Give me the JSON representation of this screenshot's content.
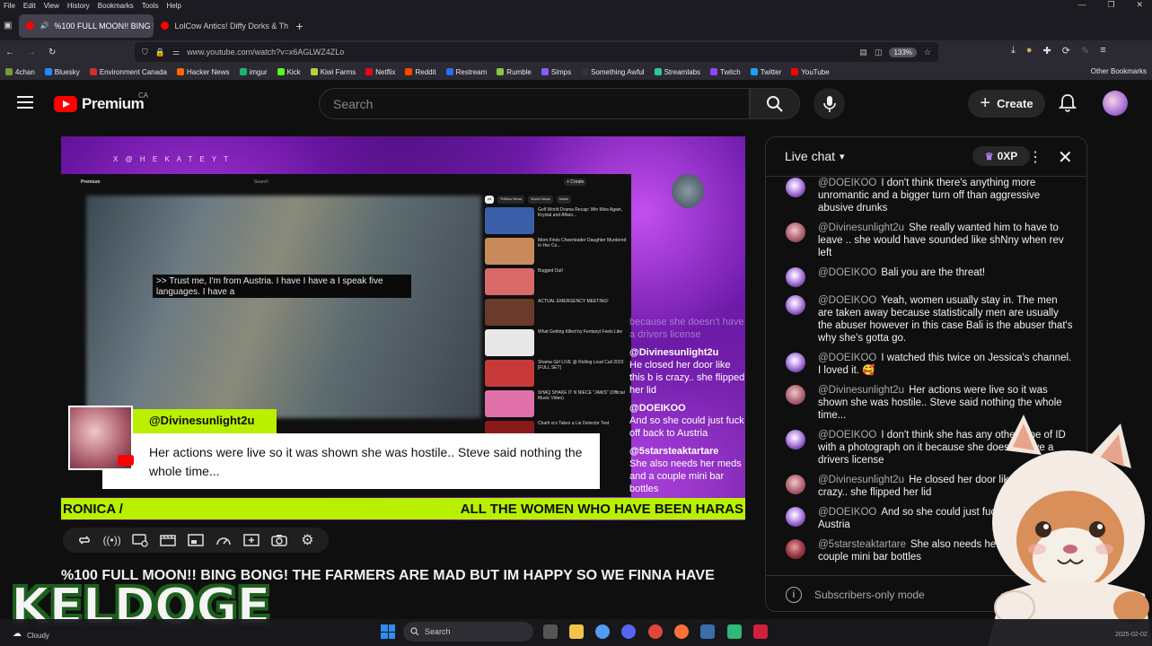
{
  "browser": {
    "menu": [
      "File",
      "Edit",
      "View",
      "History",
      "Bookmarks",
      "Tools",
      "Help"
    ],
    "tabs": [
      {
        "label": "%100 FULL MOON!! BING E",
        "active": true
      },
      {
        "label": "LolCow Antics! Diffy Dorks & Th",
        "active": false
      }
    ],
    "new_tab": "+",
    "url": "www.youtube.com/watch?v=x6AGLWZ4ZLo",
    "zoom": "133%",
    "bookmarks": [
      {
        "label": "4chan",
        "color": "#7a9a3a"
      },
      {
        "label": "Bluesky",
        "color": "#1d8cf8"
      },
      {
        "label": "Environment Canada",
        "color": "#d32f2f"
      },
      {
        "label": "Hacker News",
        "color": "#ff6600"
      },
      {
        "label": "imgur",
        "color": "#1bb76e"
      },
      {
        "label": "Kick",
        "color": "#53fc18"
      },
      {
        "label": "Kiwi Farms",
        "color": "#b5d33d"
      },
      {
        "label": "Netflix",
        "color": "#e50914"
      },
      {
        "label": "Reddit",
        "color": "#ff4500"
      },
      {
        "label": "Restream",
        "color": "#2a6cf0"
      },
      {
        "label": "Rumble",
        "color": "#85c742"
      },
      {
        "label": "Simps",
        "color": "#8a5cf6"
      },
      {
        "label": "Something Awful",
        "color": "#333333"
      },
      {
        "label": "Streamlabs",
        "color": "#31c3a2"
      },
      {
        "label": "Twitch",
        "color": "#9146ff"
      },
      {
        "label": "Twitter",
        "color": "#1da1f2"
      },
      {
        "label": "YouTube",
        "color": "#ff0000"
      }
    ],
    "other_bookmarks": "Other Bookmarks"
  },
  "youtube": {
    "logo_text": "Premium",
    "region": "CA",
    "search_placeholder": "Search",
    "create_label": "Create",
    "video_title": "%100 FULL MOON!! BING BONG! THE FARMERS ARE MAD BUT IM HAPPY SO WE FINNA HAVE"
  },
  "stream": {
    "handle": "X @ H E K A T E Y T",
    "inner_logo": "Premium",
    "inner_search": "Search",
    "inner_create": "+ Create",
    "caption": ">> Trust me, I'm from Austria. I have I have a I speak five languages. I have a",
    "chips": [
      "All",
      "Politics News",
      "World News",
      "News"
    ],
    "sidebar_videos": [
      {
        "title": "Golf World Drama Recap: Win Miss Again, Krystal and Alfaro...",
        "color": "#3a5fa8"
      },
      {
        "title": "Mom Finds Cheerleader Daughter Murdered In Her Ce...",
        "color": "#c88a5a"
      },
      {
        "title": "Bugged Out!",
        "color": "#d86a6a"
      },
      {
        "title": "ACTUAL EMERGENCY MEETING!",
        "color": "#6a3a2a"
      },
      {
        "title": "What Getting Killed by Fentanyl Feels Like",
        "color": "#e8e8e8"
      },
      {
        "title": "Shama Girl LIVE @ Rolling Loud Cali 2023 [FULL SET]",
        "color": "#c83a3a"
      },
      {
        "title": "SHAQ SHAKE IT N NIECE \"JAWS\" (Official Music Video)",
        "color": "#e070a8"
      },
      {
        "title": "Charli xcx Takes a Lie Detector Test",
        "color": "#8a1a1a"
      }
    ],
    "overlay_chat": [
      {
        "name": "",
        "text": "because she doesn't have a drivers license",
        "faded": true
      },
      {
        "name": "@Divinesunlight2u",
        "text": "He closed her door like this b is crazy.. she flipped her lid"
      },
      {
        "name": "@DOEIKOO",
        "text": "And so she could just fuck off back to Austria"
      },
      {
        "name": "@5starsteaktartare",
        "text": "She also needs her meds and a couple mini bar bottles"
      }
    ],
    "lower_third": {
      "name": "@Divinesunlight2u",
      "text": "Her actions were live so it was shown she was hostile.. Steve said nothing the whole time..."
    },
    "ticker_left": "RONICA /",
    "ticker_right": "ALL THE WOMEN WHO HAVE BEEN HARAS"
  },
  "chat": {
    "title": "Live chat",
    "xp": "0XP",
    "messages": [
      {
        "author": "@DOEIKOO",
        "text": "I don't think there's anything more unromantic and a bigger turn off than aggressive abusive drunks",
        "avatar": "a"
      },
      {
        "author": "@Divinesunlight2u",
        "text": "She really wanted him to have to leave .. she would have sounded like shNny when rev left",
        "avatar": "b"
      },
      {
        "author": "@DOEIKOO",
        "text": "Bali you are the threat!",
        "avatar": "a"
      },
      {
        "author": "@DOEIKOO",
        "text": "Yeah, women usually stay in. The men are taken away because statistically men are usually the abuser however in this case Bali is the abuser that's why she's gotta go.",
        "avatar": "a"
      },
      {
        "author": "@DOEIKOO",
        "text": "I watched this twice on Jessica's channel. I loved it. 🥰",
        "avatar": "a"
      },
      {
        "author": "@Divinesunlight2u",
        "text": "Her actions were live so it was shown she was hostile.. Steve said nothing the whole time...",
        "avatar": "b"
      },
      {
        "author": "@DOEIKOO",
        "text": "I don't think she has any other type of ID with a photograph on it because she doesn't have a drivers license",
        "avatar": "a"
      },
      {
        "author": "@Divinesunlight2u",
        "text": "He closed her door like this b is crazy.. she flipped her lid",
        "avatar": "b"
      },
      {
        "author": "@DOEIKOO",
        "text": "And so she could just fuck off back to Austria",
        "avatar": "a"
      },
      {
        "author": "@5starsteaktartare",
        "text": "She also needs her meds and a couple mini bar bottles",
        "avatar": "c"
      }
    ],
    "footer": "Subscribers-only mode"
  },
  "overlay": {
    "streamer_name": "KELDOGE"
  },
  "taskbar": {
    "weather": "Cloudy",
    "search": "Search",
    "date": "2025-02-02"
  }
}
